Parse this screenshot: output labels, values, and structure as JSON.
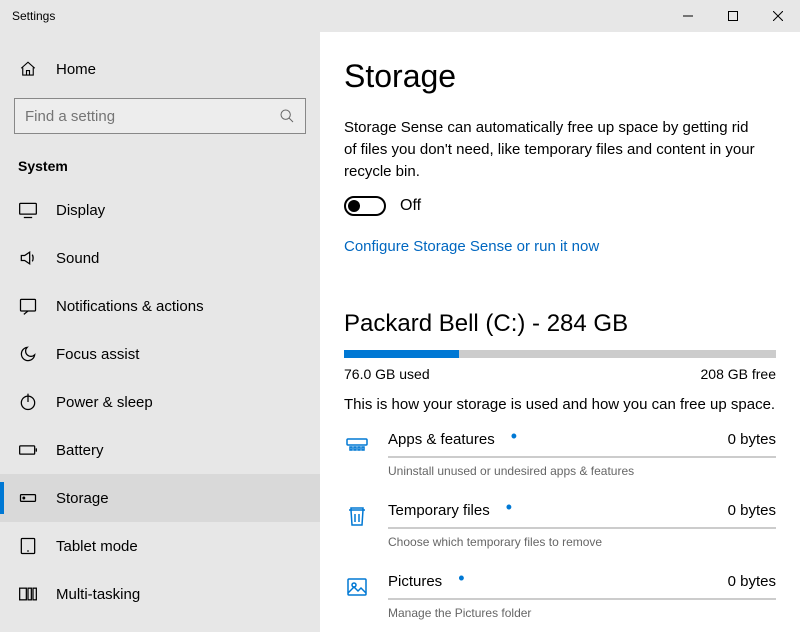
{
  "window": {
    "title": "Settings"
  },
  "sidebar": {
    "home_label": "Home",
    "search_placeholder": "Find a setting",
    "section_title": "System",
    "items": [
      {
        "label": "Display"
      },
      {
        "label": "Sound"
      },
      {
        "label": "Notifications & actions"
      },
      {
        "label": "Focus assist"
      },
      {
        "label": "Power & sleep"
      },
      {
        "label": "Battery"
      },
      {
        "label": "Storage"
      },
      {
        "label": "Tablet mode"
      },
      {
        "label": "Multi-tasking"
      }
    ]
  },
  "main": {
    "title": "Storage",
    "sense_desc": "Storage Sense can automatically free up space by getting rid of files you don't need, like temporary files and content in your recycle bin.",
    "toggle_label": "Off",
    "configure_link": "Configure Storage Sense or run it now",
    "drive": {
      "title": "Packard Bell (C:) - 284 GB",
      "used_label": "76.0 GB used",
      "free_label": "208 GB free",
      "fill_percent": 26.7
    },
    "usage_text": "This is how your storage is used and how you can free up space.",
    "categories": [
      {
        "name": "Apps & features",
        "size": "0 bytes",
        "desc": "Uninstall unused or undesired apps & features"
      },
      {
        "name": "Temporary files",
        "size": "0 bytes",
        "desc": "Choose which temporary files to remove"
      },
      {
        "name": "Pictures",
        "size": "0 bytes",
        "desc": "Manage the Pictures folder"
      }
    ]
  }
}
